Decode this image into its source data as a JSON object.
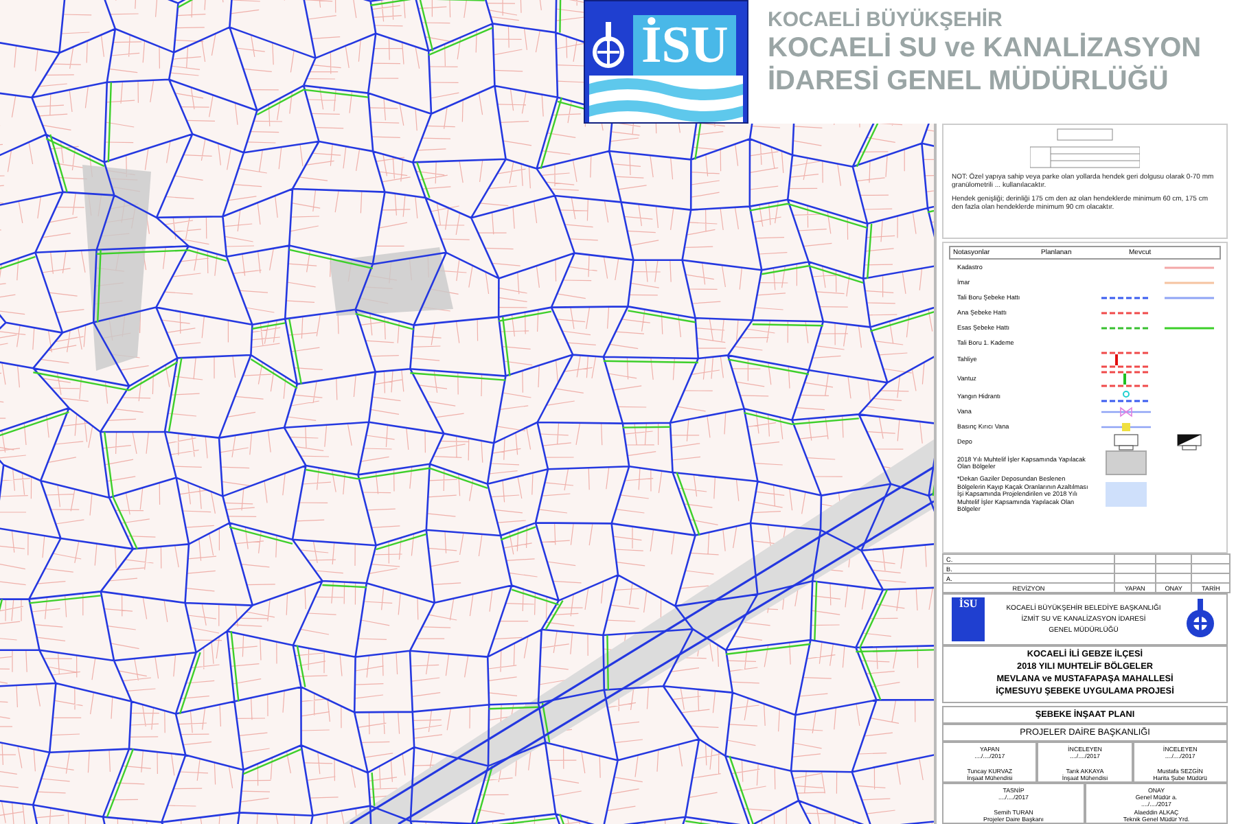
{
  "header": {
    "logo_text": "İSU",
    "brand": "KOCAELİ BÜYÜKŞEHİR",
    "org_lines": [
      "KOCAELİ SU ve KANALİZASYON",
      "İDARESİ GENEL MÜDÜRLÜĞÜ"
    ]
  },
  "notes": {
    "paragraphs": [
      "NOT: Özel yapıya sahip veya parke olan yollarda hendek geri dolgusu olarak 0-70 mm granülometrili ... kullanılacaktır.",
      "Hendek genişliği; derinliği 175 cm den az olan hendeklerde minimum 60 cm, 175 cm den fazla olan hendeklerde minimum 90 cm olacaktır."
    ]
  },
  "legend": {
    "columns": [
      "Notasyonlar",
      "Planlanan",
      "Mevcut"
    ],
    "items": [
      {
        "label": "Kadastro",
        "existing": {
          "kind": "line-pink"
        }
      },
      {
        "label": "İmar",
        "existing": {
          "kind": "line-peach"
        }
      },
      {
        "label": "Tali Boru  Şebeke Hattı",
        "planned": {
          "kind": "dash-blue"
        },
        "existing": {
          "kind": "line-blue"
        }
      },
      {
        "label": "Ana Şebeke Hattı",
        "planned": {
          "kind": "dash-red"
        }
      },
      {
        "label": "Esas Şebeke Hattı",
        "planned": {
          "kind": "dash-green"
        },
        "existing": {
          "kind": "line-green"
        }
      },
      {
        "label": "Tali Boru 1. Kademe"
      },
      {
        "label": "Tahliye",
        "planned": {
          "kind": "tahliye"
        }
      },
      {
        "label": "Vantuz",
        "planned": {
          "kind": "vantuz"
        }
      },
      {
        "label": "Yangın Hidrantı",
        "planned": {
          "kind": "hydrant"
        }
      },
      {
        "label": "Vana",
        "planned": {
          "kind": "vana"
        }
      },
      {
        "label": "Basınç Kırıcı Vana",
        "planned": {
          "kind": "pressure-valve"
        }
      },
      {
        "label": "Depo",
        "planned": {
          "kind": "depot-outline"
        },
        "existing": {
          "kind": "depot-filled"
        }
      },
      {
        "label": "2018 Yılı Muhtelif İşler Kapsamında Yapılacak Olan Bölgeler",
        "planned": {
          "kind": "hatch-grey"
        }
      },
      {
        "label": "*Dekan Gaziler Deposundan Beslenen Bölgelerin Kayıp Kaçak Oranlarının Azaltılması İşi Kapsamında Projelendirilen ve 2018 Yılı Muhtelif İşler Kapsamında Yapılacak Olan Bölgeler",
        "planned": {
          "kind": "fill-lightblue"
        }
      }
    ]
  },
  "revision": {
    "rows": [
      "C.",
      "B.",
      "A."
    ],
    "columns": [
      "REVİZYON",
      "YAPAN",
      "ONAY",
      "TARİH"
    ]
  },
  "org_logo_text": "İSU",
  "org_lines": [
    "KOCAELİ BÜYÜKŞEHİR BELEDİYE BAŞKANLIĞI",
    "İZMİT SU VE KANALİZASYON İDARESİ",
    "GENEL MÜDÜRLÜĞÜ"
  ],
  "project_title": [
    "KOCAELİ İLİ GEBZE İLÇESİ",
    "2018 YILI MUHTELİF BÖLGELER",
    "MEVLANA ve MUSTAFAPAŞA MAHALLESİ",
    "İÇMESUYU ŞEBEKE UYGULAMA PROJESİ"
  ],
  "sheet_title": "ŞEBEKE İNŞAAT PLANI",
  "department": "PROJELER DAİRE BAŞKANLIĞI",
  "signatures": [
    [
      {
        "role": "YAPAN",
        "date": "..../..../2017",
        "name": "Tuncay KURVAZ",
        "title": "İnşaat Mühendisi"
      },
      {
        "role": "İNCELEYEN",
        "date": "..../..../2017",
        "name": "Tarık AKKAYA",
        "title": "İnşaat Mühendisi"
      },
      {
        "role": "İNCELEYEN",
        "date": "..../..../2017",
        "name": "Mustafa SEZGİN",
        "title": "Harita Şube Müdürü"
      }
    ],
    [
      {
        "role": "TASNİP",
        "date": "..../..../2017",
        "name": "Semih TURAN",
        "title": "Projeler Daire Başkanı"
      },
      {
        "role": "ONAY",
        "subtitle": "Genel Müdür a.",
        "date": "..../..../2017",
        "name": "Alaeddin ALKAÇ",
        "title": "Teknik Genel Müdür Yrd."
      }
    ]
  ]
}
